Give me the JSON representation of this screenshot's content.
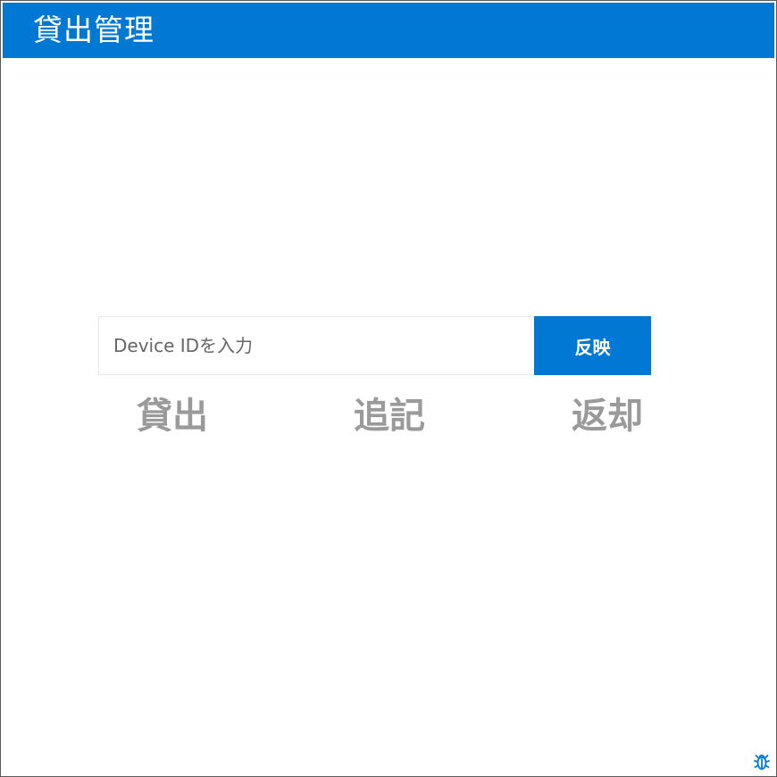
{
  "header": {
    "title": "貸出管理"
  },
  "device_search": {
    "placeholder": "Device IDを入力",
    "value": "",
    "apply_label": "反映"
  },
  "actions": {
    "lend_label": "貸出",
    "append_label": "追記",
    "return_label": "返却"
  },
  "debug": {
    "icon": "bug-icon"
  },
  "colors": {
    "accent": "#0078d4",
    "action_text": "#9a9a9a",
    "header_text": "#ffffff"
  }
}
